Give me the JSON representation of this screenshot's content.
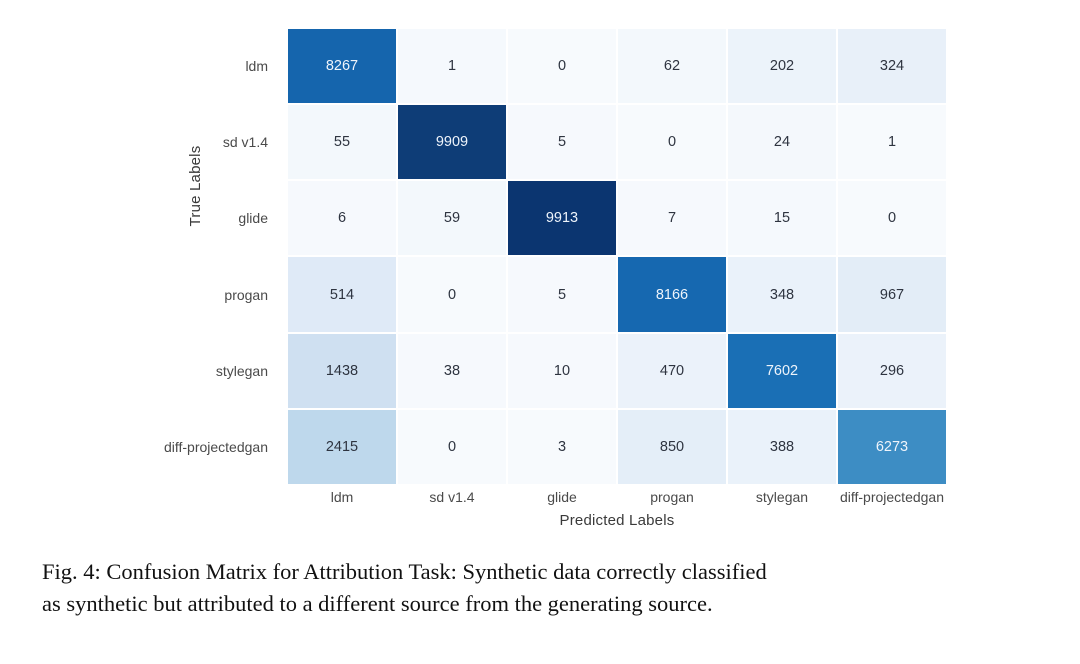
{
  "figure": {
    "caption_line1": "Fig. 4: Confusion Matrix for Attribution Task: Synthetic data correctly classified",
    "caption_line2": "as synthetic but attributed to a different source from the generating source."
  },
  "chart_data": {
    "type": "heatmap",
    "title": "",
    "xlabel": "Predicted Labels",
    "ylabel": "True Labels",
    "categories_x": [
      "ldm",
      "sd v1.4",
      "glide",
      "progan",
      "stylegan",
      "diff-projectedgan"
    ],
    "categories_y": [
      "ldm",
      "sd v1.4",
      "glide",
      "progan",
      "stylegan",
      "diff-projectedgan"
    ],
    "values": [
      [
        8267,
        1,
        0,
        62,
        202,
        324
      ],
      [
        55,
        9909,
        5,
        0,
        24,
        1
      ],
      [
        6,
        59,
        9913,
        7,
        15,
        0
      ],
      [
        514,
        0,
        5,
        8166,
        348,
        967
      ],
      [
        1438,
        38,
        10,
        470,
        7602,
        296
      ],
      [
        2415,
        0,
        3,
        850,
        388,
        6273
      ]
    ],
    "vmin": 0,
    "vmax": 9913,
    "colormap": "Blues",
    "grid": false,
    "legend": "none",
    "colors": [
      [
        "#1565ad",
        "#f5f9fd",
        "#f7fafd",
        "#f3f8fc",
        "#ecf3fa",
        "#e8f0f9"
      ],
      [
        "#f3f8fc",
        "#0e3d77",
        "#f6f9fd",
        "#f7fafd",
        "#f4f8fc",
        "#f7fafd"
      ],
      [
        "#f6f9fd",
        "#f3f8fc",
        "#0b3570",
        "#f6f9fd",
        "#f5f9fd",
        "#f7fafd"
      ],
      [
        "#dfeaf7",
        "#f7fafd",
        "#f6f9fd",
        "#1668b0",
        "#eaf2fa",
        "#e3edf7"
      ],
      [
        "#cfe0f1",
        "#f6f9fd",
        "#f6f9fd",
        "#ebf2fa",
        "#1a6fb5",
        "#ebf2fa"
      ],
      [
        "#bed8ec",
        "#f7fafd",
        "#f7fafd",
        "#e4eef8",
        "#eaf2fa",
        "#3d8dc4"
      ]
    ],
    "text_colors": [
      [
        "dark",
        "light",
        "light",
        "light",
        "light",
        "light"
      ],
      [
        "light",
        "dark",
        "light",
        "light",
        "light",
        "light"
      ],
      [
        "light",
        "light",
        "dark",
        "light",
        "light",
        "light"
      ],
      [
        "light",
        "light",
        "light",
        "dark",
        "light",
        "light"
      ],
      [
        "light",
        "light",
        "light",
        "light",
        "dark",
        "light"
      ],
      [
        "light",
        "light",
        "light",
        "light",
        "light",
        "dark"
      ]
    ]
  }
}
